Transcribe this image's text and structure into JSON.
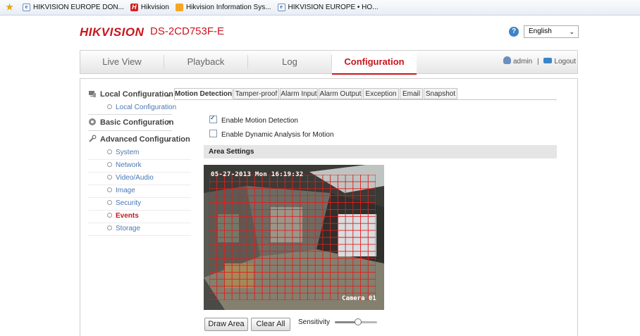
{
  "favorites": [
    {
      "icon": "star-icon",
      "label": ""
    },
    {
      "icon": "page-icon",
      "label": "HIKVISION EUROPE DON..."
    },
    {
      "icon": "hikvision-icon",
      "label": "Hikvision"
    },
    {
      "icon": "sun-icon",
      "label": "Hikvision Information Sys..."
    },
    {
      "icon": "page-icon",
      "label": "HIKVISION EUROPE • HO..."
    }
  ],
  "header": {
    "logo": "HIKVISION",
    "model": "DS-2CD753F-E",
    "help_icon": "?",
    "language": "English"
  },
  "nav": {
    "tabs": [
      "Live View",
      "Playback",
      "Log",
      "Configuration"
    ],
    "active": "Configuration",
    "user": "admin",
    "separator": "|",
    "logout": "Logout"
  },
  "sidebar": {
    "local": {
      "label": "Local Configuration",
      "sub": "Local Configuration"
    },
    "basic": {
      "label": "Basic Configuration"
    },
    "advanced": {
      "label": "Advanced Configuration",
      "items": [
        "System",
        "Network",
        "Video/Audio",
        "Image",
        "Security",
        "Events",
        "Storage"
      ],
      "active": "Events"
    }
  },
  "tabs": [
    "Motion Detection",
    "Tamper-proof",
    "Alarm Input",
    "Alarm Output",
    "Exception",
    "Email",
    "Snapshot"
  ],
  "active_tab": "Motion Detection",
  "options": {
    "enable_motion": {
      "label": "Enable Motion Detection",
      "checked": true
    },
    "enable_dynamic": {
      "label": "Enable Dynamic Analysis for Motion",
      "checked": false
    }
  },
  "area": {
    "title": "Area Settings",
    "osd_time": "05-27-2013 Mon 16:19:32",
    "osd_camera": "Camera 01",
    "grid_color": "#e01e1e"
  },
  "controls": {
    "draw_area": "Draw Area",
    "clear_all": "Clear All",
    "sensitivity_label": "Sensitivity",
    "sensitivity_level": 0.55
  },
  "colors": {
    "brand": "#c8161d",
    "link": "#4a78b5"
  }
}
